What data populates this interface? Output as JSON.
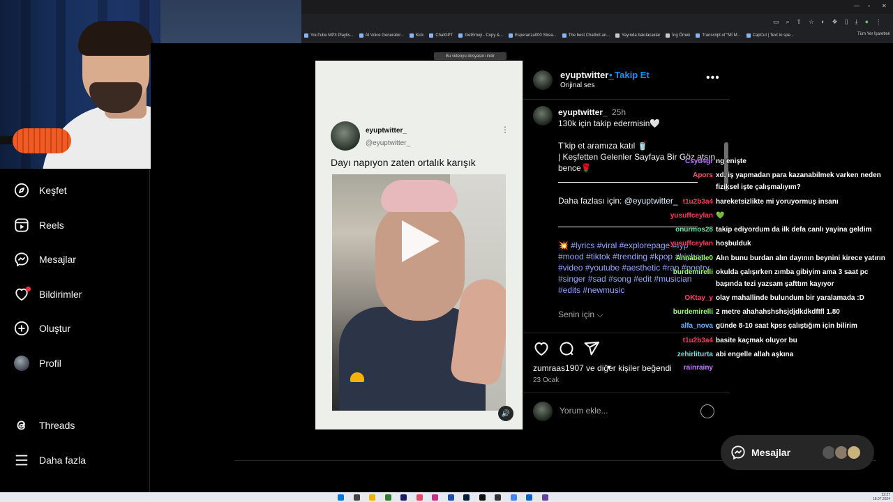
{
  "browser": {
    "bookmarks": [
      {
        "label": "YouTube MP3 Playlis...",
        "kind": "page"
      },
      {
        "label": "AI Voice Generator...",
        "kind": "page"
      },
      {
        "label": "Kick",
        "kind": "page"
      },
      {
        "label": "ChatGPT",
        "kind": "page"
      },
      {
        "label": "GetEmoji - Copy &...",
        "kind": "page"
      },
      {
        "label": "Esperanza000 Strea...",
        "kind": "page"
      },
      {
        "label": "The best Chatbot an...",
        "kind": "page"
      },
      {
        "label": "Yayında bakılacaklar",
        "kind": "folder"
      },
      {
        "label": "İng Ömek",
        "kind": "folder"
      },
      {
        "label": "Transcript of \"Mİ M...",
        "kind": "page"
      },
      {
        "label": "CapCut | Text to spe...",
        "kind": "page"
      }
    ],
    "all_bookmarks": "Tüm Yer İşaretleri",
    "download_hint": "Bu videoyu dosyasını indir"
  },
  "nav": {
    "items": [
      {
        "label": "Keşfet",
        "icon": "compass-icon"
      },
      {
        "label": "Reels",
        "icon": "reels-icon"
      },
      {
        "label": "Mesajlar",
        "icon": "messenger-icon"
      },
      {
        "label": "Bildirimler",
        "icon": "heart-icon"
      },
      {
        "label": "Oluştur",
        "icon": "plus-square-icon"
      },
      {
        "label": "Profil",
        "icon": "avatar"
      }
    ],
    "threads": "Threads",
    "more": "Daha fazla"
  },
  "post": {
    "tweet": {
      "name": "eyuptwitter_",
      "handle": "@eyuptwitter_",
      "text": "Dayı napıyon zaten ortalık karışık"
    },
    "header": {
      "username": "eyuptwitter_",
      "follow": "Takip Et",
      "audio": "Orijinal ses"
    },
    "caption": {
      "username": "eyuptwitter_",
      "time": "25h",
      "line1": "130k için takip edermisin🤍",
      "line2": "T'kip et aramıza katıl 🥤",
      "line3": "| Keşfetten Gelenler Sayfaya Bir Göz atsın",
      "line4": "bence🌹",
      "more_prefix": "Daha fazlası için: ",
      "mention": "@eyuptwitter_",
      "tags": "💥 #lyrics #viral #explorepage #fyp #mood #tiktok #trending #kpop #hiphop #video #youtube #aesthetic #rap #poetry #singer #sad #song #edit #musician #edits #newmusic",
      "for_you": "Senin için ⌵"
    },
    "likes": "zumraas1907 ve diğer kişiler beğendi",
    "date": "23 Ocak",
    "comment_placeholder": "Yorum ekle..."
  },
  "chat": [
    {
      "user": "Csyd4gr",
      "text": "ng enişte",
      "color": "#c47cff"
    },
    {
      "user": "Apors",
      "text": "xd, iş yapmadan para kazanabilmek varken neden",
      "color": "#ff4a6e"
    },
    {
      "user": "",
      "text": "fiziksel işte çalışmalıyım?",
      "color": "#ffffff"
    },
    {
      "user": "t1u2b3a4",
      "text": "hareketsizlikte mi yoruyormuş insanı",
      "color": "#ff3b5c"
    },
    {
      "user": "yusuffceylan",
      "text": "💚",
      "color": "#ff3b5c"
    },
    {
      "user": "onurmos28",
      "text": "takip ediyordum da ilk defa canlı yayina geldim",
      "color": "#6fe3a8"
    },
    {
      "user": "yusuffceylan",
      "text": "hoşbulduk",
      "color": "#ff3b5c"
    },
    {
      "user": "Annabelle0",
      "text": "Alın bunu burdan alın dayının beynini kirece yatırın",
      "color": "#9cff66"
    },
    {
      "user": "burdemirelli",
      "text": "okulda çalışırken zımba gibiyim ama 3 saat pc",
      "color": "#9cff66"
    },
    {
      "user": "",
      "text": "başında tezi yazsam şafttım kayıyor",
      "color": "#ffffff"
    },
    {
      "user": "OKtay_y",
      "text": "olay mahallinde bulundum bir yaralamada :D",
      "color": "#ff4a6e"
    },
    {
      "user": "burdemirelli",
      "text": "2 metre ahahahshshsjdjdkdkdfIfl 1.80",
      "color": "#9cff66"
    },
    {
      "user": "alfa_nova",
      "text": "günde 8-10 saat kpss çalıştığım için bilirim",
      "color": "#6ab7ff"
    },
    {
      "user": "t1u2b3a4",
      "text": "basite kaçmak oluyor bu",
      "color": "#ff3b5c"
    },
    {
      "user": "zehirliturta",
      "text": "abi engelle allah aşkına",
      "color": "#6fe3d8"
    },
    {
      "user": "rainrainy",
      "text": "♥",
      "color": "#c47cff"
    }
  ],
  "messages_pill": "Mesajlar",
  "taskbar": {
    "time": "22:27",
    "date": "18.07.2024"
  },
  "colors": {
    "accent": "#0095f6",
    "bg": "#000000",
    "notif": "#ff3040"
  }
}
